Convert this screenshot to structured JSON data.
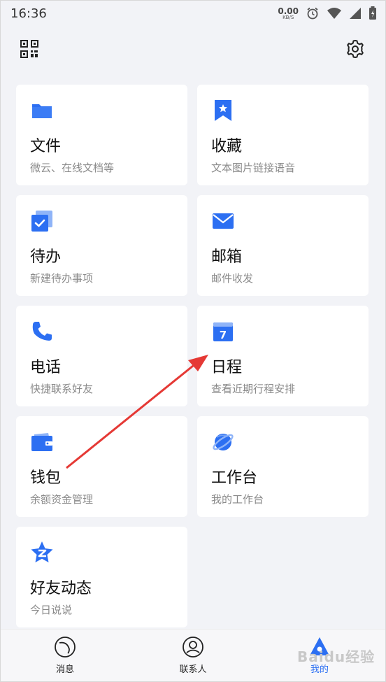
{
  "statusbar": {
    "time": "16:36",
    "speed_value": "0.00",
    "speed_unit": "KB/S"
  },
  "cards": [
    {
      "title": "文件",
      "sub": "微云、在线文档等",
      "icon": "folder-icon"
    },
    {
      "title": "收藏",
      "sub": "文本图片链接语音",
      "icon": "bookmark-icon"
    },
    {
      "title": "待办",
      "sub": "新建待办事项",
      "icon": "todo-check-icon"
    },
    {
      "title": "邮箱",
      "sub": "邮件收发",
      "icon": "mail-icon"
    },
    {
      "title": "电话",
      "sub": "快捷联系好友",
      "icon": "phone-icon"
    },
    {
      "title": "日程",
      "sub": "查看近期行程安排",
      "icon": "calendar-icon",
      "calendar_day": "7"
    },
    {
      "title": "钱包",
      "sub": "余额资金管理",
      "icon": "wallet-icon"
    },
    {
      "title": "工作台",
      "sub": "我的工作台",
      "icon": "planet-icon"
    },
    {
      "title": "好友动态",
      "sub": "今日说说",
      "icon": "qzone-star-icon"
    }
  ],
  "bottom_nav": [
    {
      "label": "消息",
      "icon": "message-icon"
    },
    {
      "label": "联系人",
      "icon": "contacts-icon"
    },
    {
      "label": "我的",
      "icon": "me-icon",
      "active": true
    }
  ],
  "watermark": "Baidu经验",
  "colors": {
    "accent": "#2c6ff2",
    "background": "#f2f3f7",
    "annotation_arrow": "#e53935"
  }
}
